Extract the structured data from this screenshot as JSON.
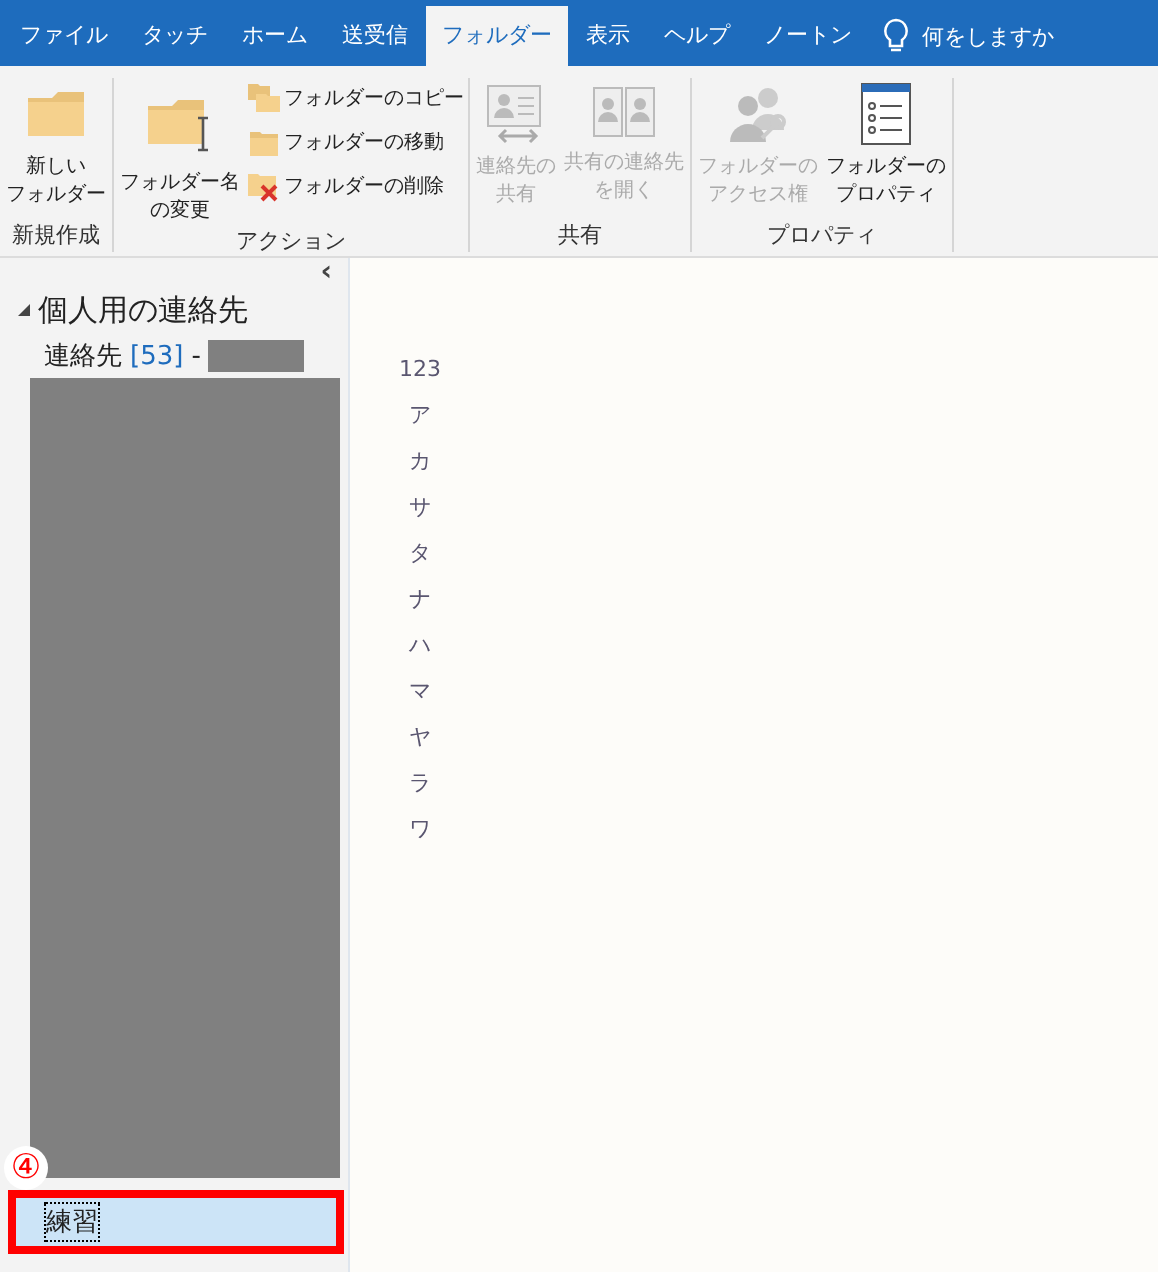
{
  "tabs": [
    {
      "label": "ファイル",
      "selected": false
    },
    {
      "label": "タッチ",
      "selected": false
    },
    {
      "label": "ホーム",
      "selected": false
    },
    {
      "label": "送受信",
      "selected": false
    },
    {
      "label": "フォルダー",
      "selected": true
    },
    {
      "label": "表示",
      "selected": false
    },
    {
      "label": "ヘルプ",
      "selected": false
    },
    {
      "label": "ノートン",
      "selected": false
    }
  ],
  "tell_me": {
    "label": "何をしますか"
  },
  "ribbon_groups": [
    {
      "label": "新規作成",
      "buttons": [
        {
          "kind": "large",
          "lines": [
            "新しい",
            "フォルダー"
          ],
          "disabled": false
        }
      ]
    },
    {
      "label": "アクション",
      "buttons": [
        {
          "kind": "large",
          "lines": [
            "フォルダー名",
            "の変更"
          ],
          "disabled": false
        },
        {
          "kind": "small",
          "lines": [
            "フォルダーのコピー"
          ],
          "disabled": false
        },
        {
          "kind": "small",
          "lines": [
            "フォルダーの移動"
          ],
          "disabled": false
        },
        {
          "kind": "small",
          "lines": [
            "フォルダーの削除"
          ],
          "disabled": false
        }
      ]
    },
    {
      "label": "共有",
      "buttons": [
        {
          "kind": "large",
          "lines": [
            "連絡先の",
            "共有"
          ],
          "disabled": true
        },
        {
          "kind": "large",
          "lines": [
            "共有の連絡先",
            "を開く"
          ],
          "disabled": true
        }
      ]
    },
    {
      "label": "プロパティ",
      "buttons": [
        {
          "kind": "large",
          "lines": [
            "フォルダーの",
            "アクセス権"
          ],
          "disabled": true
        },
        {
          "kind": "large",
          "lines": [
            "フォルダーの",
            "プロパティ"
          ],
          "disabled": false
        }
      ]
    }
  ],
  "folder_pane": {
    "collapse": "‹",
    "root": {
      "label": "個人用の連絡先",
      "expanded": true
    },
    "contacts": {
      "label": "連絡先",
      "count": "[53]",
      "separator": "-"
    },
    "selected_folder": {
      "label": "練習",
      "selected": true
    }
  },
  "annotation": {
    "number": "④"
  },
  "index_letters": [
    "123",
    "ア",
    "カ",
    "サ",
    "タ",
    "ナ",
    "ハ",
    "マ",
    "ヤ",
    "ラ",
    "ワ"
  ]
}
